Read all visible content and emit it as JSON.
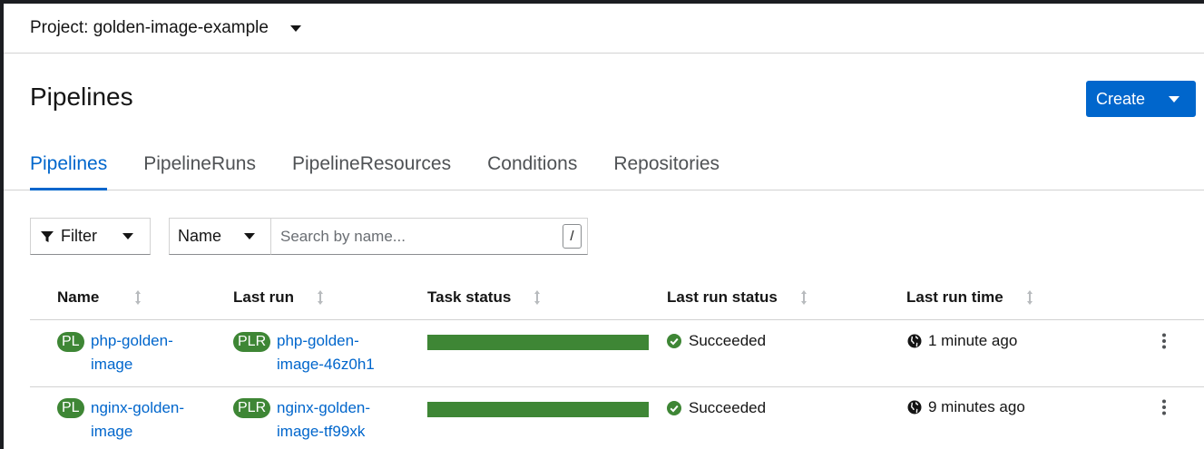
{
  "project": {
    "label": "Project: golden-image-example"
  },
  "page": {
    "title": "Pipelines"
  },
  "create": {
    "label": "Create"
  },
  "tabs": [
    {
      "label": "Pipelines",
      "active": true
    },
    {
      "label": "PipelineRuns"
    },
    {
      "label": "PipelineResources"
    },
    {
      "label": "Conditions"
    },
    {
      "label": "Repositories"
    }
  ],
  "filter": {
    "label": "Filter"
  },
  "search": {
    "field": "Name",
    "placeholder": "Search by name...",
    "shortcut": "/"
  },
  "table": {
    "columns": [
      "Name",
      "Last run",
      "Task status",
      "Last run status",
      "Last run time"
    ],
    "rows": [
      {
        "name_badge": "PL",
        "name_line1": "php-golden-",
        "name_line2": "image",
        "run_badge": "PLR",
        "run_line1": "php-golden-",
        "run_line2": "image-46z0h1",
        "task_status_succeeded_fraction": 1.0,
        "status": "Succeeded",
        "time": "1 minute ago"
      },
      {
        "name_badge": "PL",
        "name_line1": "nginx-golden-",
        "name_line2": "image",
        "run_badge": "PLR",
        "run_line1": "nginx-golden-",
        "run_line2": "image-tf99xk",
        "task_status_succeeded_fraction": 1.0,
        "status": "Succeeded",
        "time": "9 minutes ago"
      }
    ]
  },
  "colors": {
    "primary": "#0066cc",
    "success": "#3e8635",
    "border": "#d2d2d2"
  }
}
